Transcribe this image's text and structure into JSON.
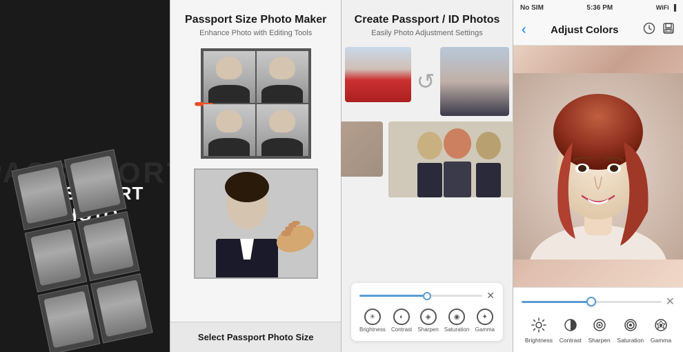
{
  "panels": {
    "panel1": {
      "bg_text": "PASSOPORT",
      "title_line1": "PASSOPORT",
      "title_line2": "PHOTO"
    },
    "panel2": {
      "title": "Passport Size Photo Maker",
      "subtitle": "Enhance Photo with Editing Tools",
      "bottom_button": "Select Passport Photo Size"
    },
    "panel3": {
      "title": "Create Passport / ID Photos",
      "subtitle": "Easily Photo Adjustment Settings"
    },
    "panel4": {
      "status": {
        "carrier": "No SIM",
        "time": "5:36 PM",
        "icons": "⚡🔋"
      },
      "header": {
        "back_label": "‹",
        "title": "Adjust Colors",
        "history_icon": "🕐",
        "save_icon": "💾"
      },
      "controls": {
        "close_icon": "✕",
        "icons": [
          {
            "label": "Brightness",
            "symbol": "☀"
          },
          {
            "label": "Contrast",
            "symbol": "◐"
          },
          {
            "label": "Sharpen",
            "symbol": "◈"
          },
          {
            "label": "Saturation",
            "symbol": "◉"
          },
          {
            "label": "Gamma",
            "symbol": "✦"
          }
        ]
      }
    }
  },
  "adjust_icons": [
    {
      "label": "Brightness",
      "symbol": "☀"
    },
    {
      "label": "Contrast",
      "symbol": "◐"
    },
    {
      "label": "Sharpen",
      "symbol": "◈"
    },
    {
      "label": "Saturation",
      "symbol": "◉"
    },
    {
      "label": "Gamma",
      "symbol": "✦"
    }
  ]
}
